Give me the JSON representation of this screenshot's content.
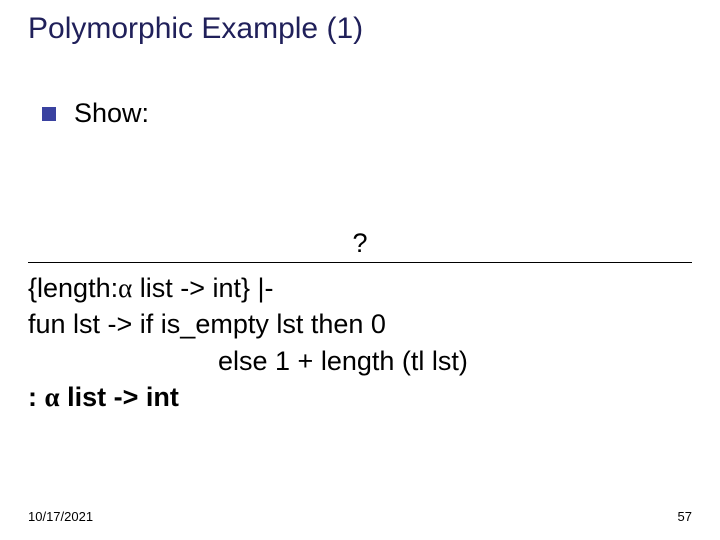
{
  "title": "Polymorphic Example (1)",
  "bullet": "Show:",
  "question": "?",
  "proof": {
    "line1_pre": "{length:",
    "line1_alpha": "α",
    "line1_post": " list -> int} |-",
    "line2": "fun lst -> if is_empty lst then 0",
    "line3": "else 1 + length (tl lst)",
    "line4_pre": ": ",
    "line4_alpha": "α",
    "line4_post": " list -> int"
  },
  "footer": {
    "date": "10/17/2021",
    "page": "57"
  }
}
